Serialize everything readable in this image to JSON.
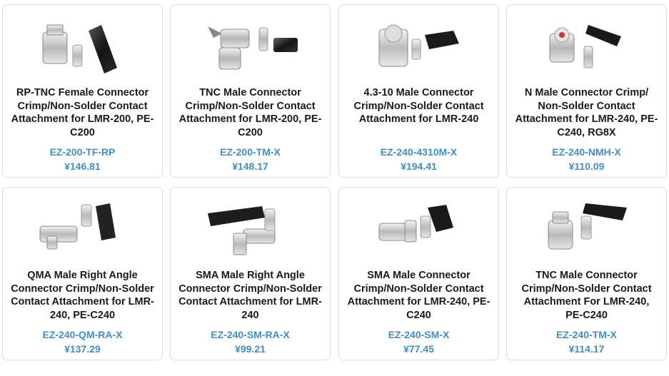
{
  "products": [
    {
      "title": "RP-TNC Female Connector Crimp/Non-Solder Contact Attachment for LMR-200, PE-C200",
      "sku": "EZ-200-TF-RP",
      "price": "¥146.81"
    },
    {
      "title": "TNC Male Connector Crimp/Non-Solder Contact Attachment for LMR-200, PE-C200",
      "sku": "EZ-200-TM-X",
      "price": "¥148.17"
    },
    {
      "title": "4.3-10 Male Connector Crimp/Non-Solder Contact Attachment for LMR-240",
      "sku": "EZ-240-4310M-X",
      "price": "¥194.41"
    },
    {
      "title": "N Male Connector Crimp/ Non-Solder Contact Attachment for LMR-240, PE-C240, RG8X",
      "sku": "EZ-240-NMH-X",
      "price": "¥110.09"
    },
    {
      "title": "QMA Male Right Angle Connector Crimp/Non-Solder Contact Attachment for LMR-240, PE-C240",
      "sku": "EZ-240-QM-RA-X",
      "price": "¥137.29"
    },
    {
      "title": "SMA Male Right Angle Connector Crimp/Non-Solder Contact Attachment for LMR-240",
      "sku": "EZ-240-SM-RA-X",
      "price": "¥99.21"
    },
    {
      "title": "SMA Male Connector Crimp/Non-Solder Contact Attachment for LMR-240, PE-C240",
      "sku": "EZ-240-SM-X",
      "price": "¥77.45"
    },
    {
      "title": "TNC Male Connector Crimp/Non-Solder Contact Attachment For LMR-240, PE-C240",
      "sku": "EZ-240-TM-X",
      "price": "¥114.17"
    }
  ]
}
